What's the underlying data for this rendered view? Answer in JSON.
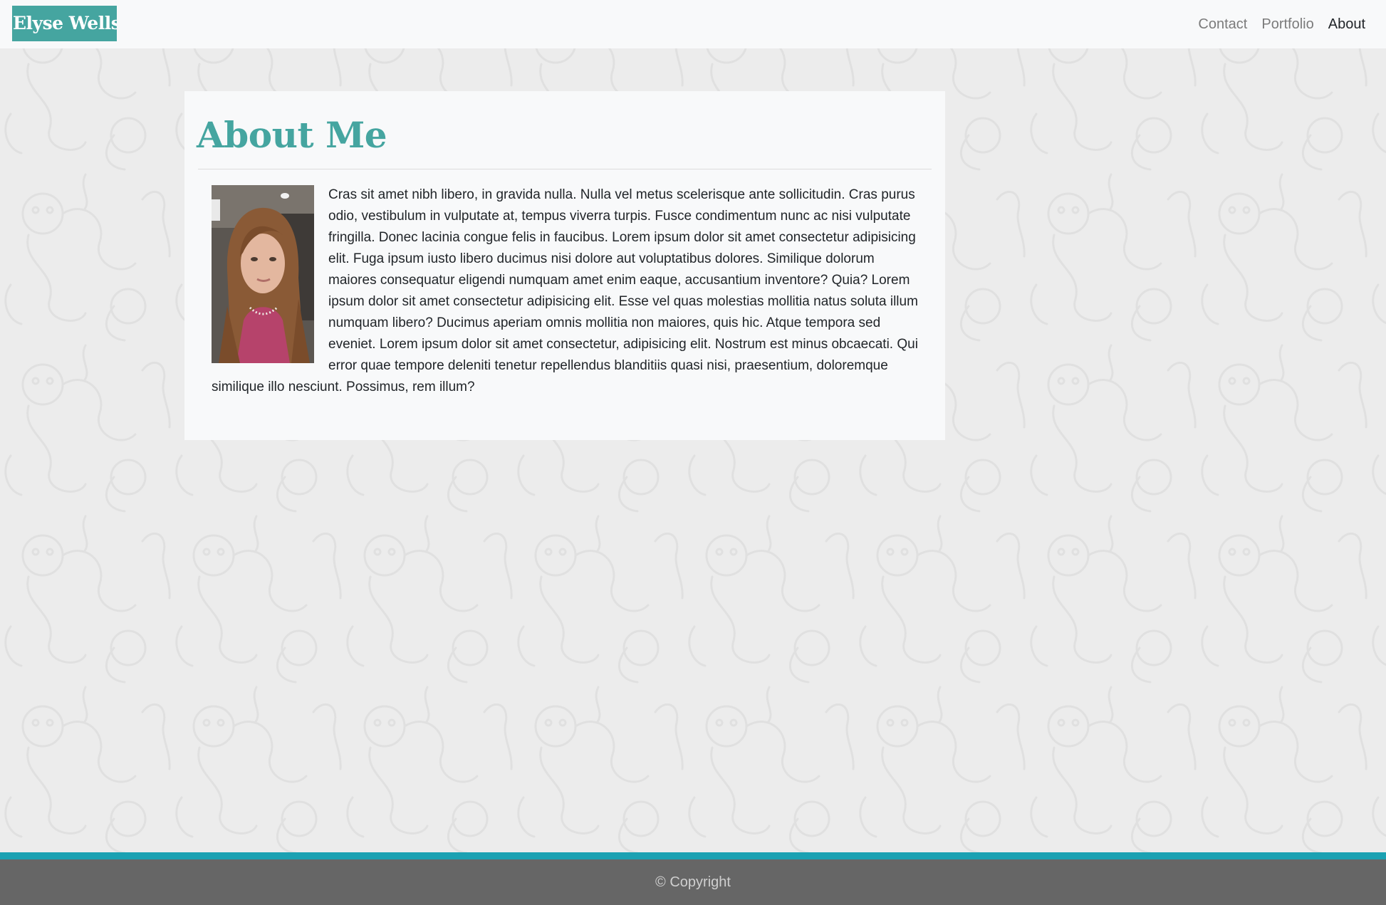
{
  "nav": {
    "brand": "Elyse Wells",
    "links": [
      {
        "label": "Contact"
      },
      {
        "label": "Portfolio"
      },
      {
        "label": "About"
      }
    ]
  },
  "about": {
    "title": "About Me",
    "body": "Cras sit amet nibh libero, in gravida nulla. Nulla vel metus scelerisque ante sollicitudin. Cras purus odio, vestibulum in vulputate at, tempus viverra turpis. Fusce condimentum nunc ac nisi vulputate fringilla. Donec lacinia congue felis in faucibus. Lorem ipsum dolor sit amet consectetur adipisicing elit. Fuga ipsum iusto libero ducimus nisi dolore aut voluptatibus dolores. Similique dolorum maiores consequatur eligendi numquam amet enim eaque, accusantium inventore? Quia? Lorem ipsum dolor sit amet consectetur adipisicing elit. Esse vel quas molestias mollitia natus soluta illum numquam libero? Ducimus aperiam omnis mollitia non maiores, quis hic. Atque tempora sed eveniet. Lorem ipsum dolor sit amet consectetur, adipisicing elit. Nostrum est minus obcaecati. Qui error quae tempore deleniti tenetur repellendus blanditiis quasi nisi, praesentium, doloremque similique illo nesciunt. Possimus, rem illum?"
  },
  "footer": {
    "copyright": "© Copyright"
  },
  "colors": {
    "accent": "#45a5a0",
    "footer_stripe": "#1ba1b2",
    "footer_bg": "#666666",
    "page_bg": "#ececec"
  }
}
